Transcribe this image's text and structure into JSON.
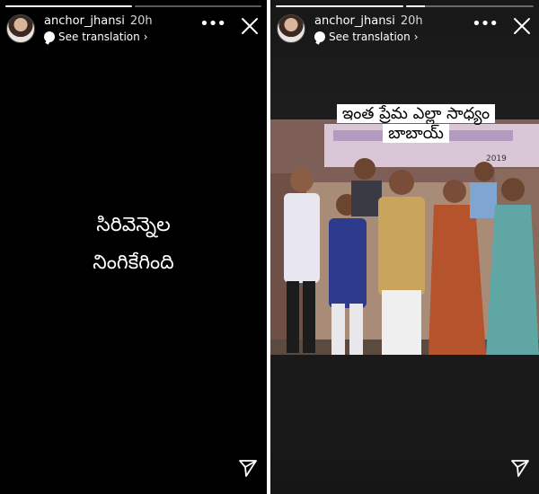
{
  "stories": [
    {
      "username": "anchor_jhansi",
      "time": "20h",
      "translation_label": "See translation",
      "text_lines": [
        "సిరివెన్నెల",
        "నింగికేగింది"
      ],
      "progress": [
        1.0,
        0.0
      ]
    },
    {
      "username": "anchor_jhansi",
      "time": "20h",
      "translation_label": "See translation",
      "caption_lines": [
        "ఇంత ప్రేమ ఎల్లా సాధ్యం",
        "బాబాయ్"
      ],
      "banner_year": "2019",
      "progress": [
        1.0,
        0.15
      ]
    }
  ],
  "icons": {
    "more": "more-horizontal-icon",
    "close": "close-icon",
    "send": "send-icon",
    "translation": "speech-bubble-icon"
  }
}
